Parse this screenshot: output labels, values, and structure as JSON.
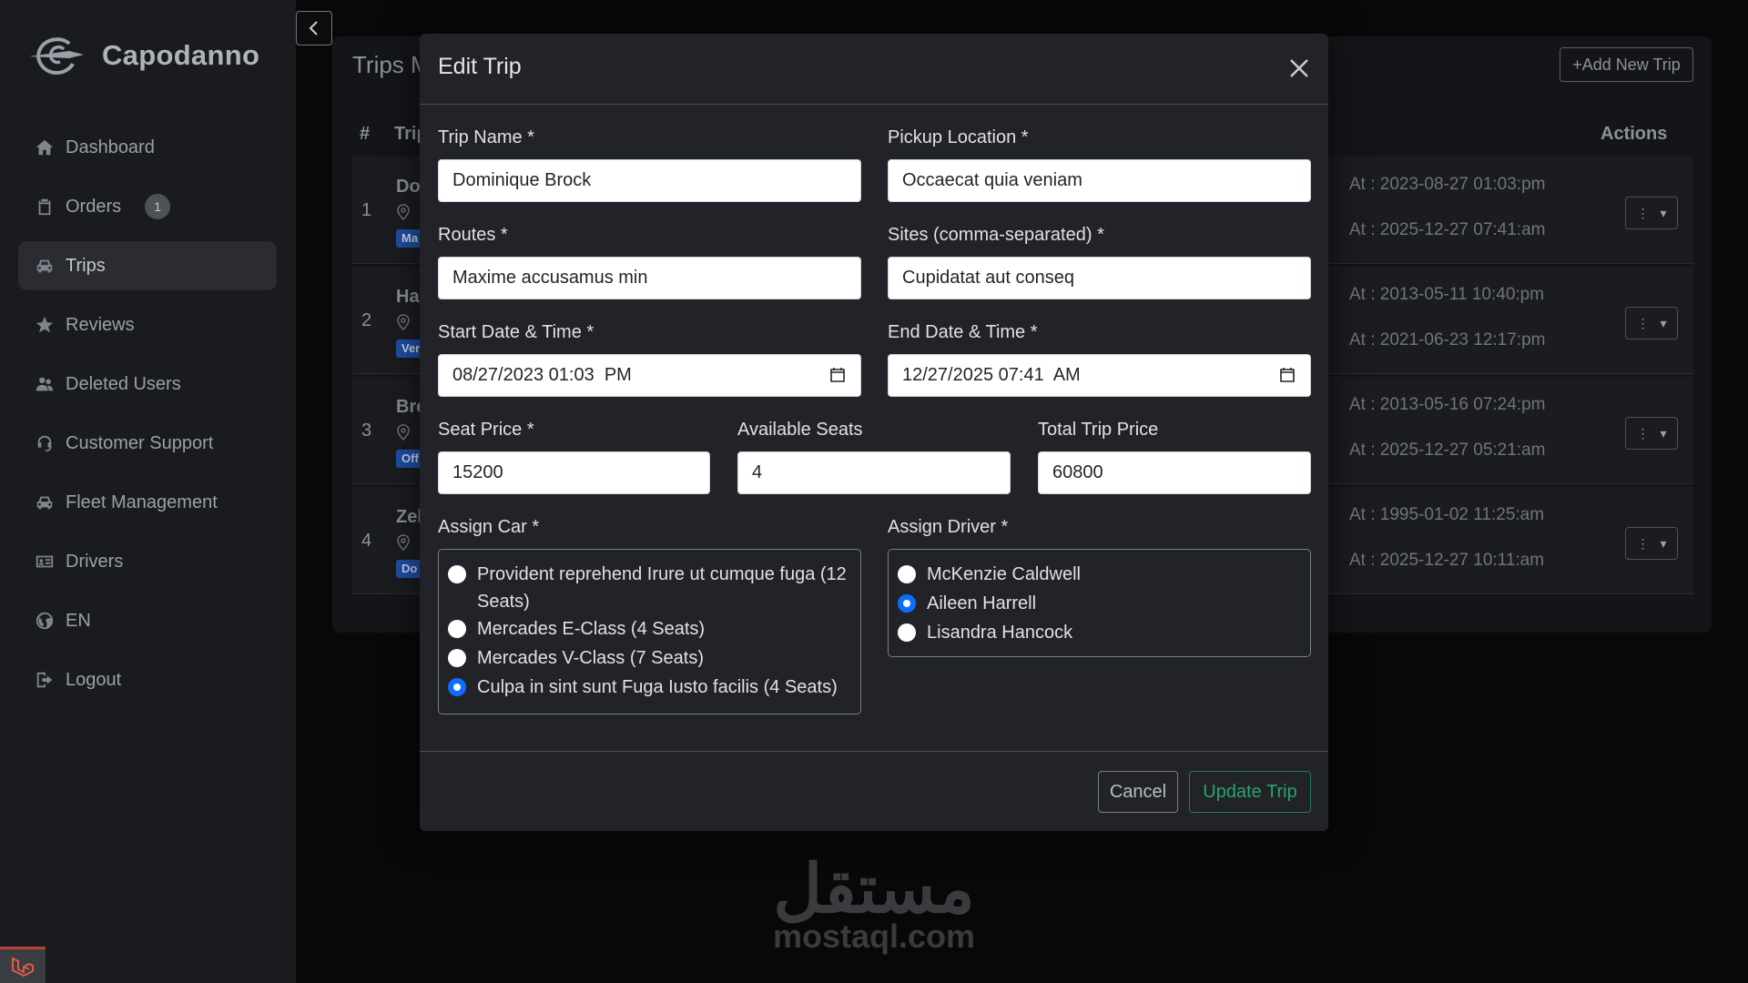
{
  "app": {
    "name": "Capodanno"
  },
  "sidebar": {
    "items": [
      {
        "label": "Dashboard",
        "icon": "home-icon"
      },
      {
        "label": "Orders",
        "icon": "clipboard-icon",
        "badge": "1"
      },
      {
        "label": "Trips",
        "icon": "car-icon",
        "active": true
      },
      {
        "label": "Reviews",
        "icon": "star-icon"
      },
      {
        "label": "Deleted Users",
        "icon": "users-icon"
      },
      {
        "label": "Customer Support",
        "icon": "headset-icon"
      },
      {
        "label": "Fleet Management",
        "icon": "car-icon"
      },
      {
        "label": "Drivers",
        "icon": "id-card-icon"
      },
      {
        "label": "EN",
        "icon": "globe-icon"
      },
      {
        "label": "Logout",
        "icon": "logout-icon"
      }
    ]
  },
  "page": {
    "title": "Trips M",
    "add_button": "+Add New Trip",
    "columns": {
      "num": "#",
      "trip": "Trip",
      "actions": "Actions"
    },
    "rows": [
      {
        "num": "1",
        "name": "Do",
        "pin": "c",
        "tag": "Ma",
        "t1": "At : 2023-08-27 01:03:pm",
        "t2": "At : 2025-12-27 07:41:am"
      },
      {
        "num": "2",
        "name": "Ha",
        "pin": "l",
        "tag": "Ver",
        "t1": "At : 2013-05-11 10:40:pm",
        "t2": "At : 2021-06-23 12:17:pm"
      },
      {
        "num": "3",
        "name": "Bre",
        "pin": "l",
        "tag": "Off",
        "t1": "At : 2013-05-16 07:24:pm",
        "t2": "At : 2025-12-27 05:21:am"
      },
      {
        "num": "4",
        "name": "Zel",
        "pin": "A",
        "tag": "Do",
        "t1": "At : 1995-01-02 11:25:am",
        "t2": "At : 2025-12-27 10:11:am"
      }
    ]
  },
  "modal": {
    "title": "Edit Trip",
    "trip_name": {
      "label": "Trip Name *",
      "value": "Dominique Brock"
    },
    "pickup": {
      "label": "Pickup Location *",
      "value": "Occaecat quia veniam"
    },
    "routes": {
      "label": "Routes *",
      "value": "Maxime accusamus min"
    },
    "sites": {
      "label": "Sites (comma-separated) *",
      "value": "Cupidatat aut conseq"
    },
    "start": {
      "label": "Start Date & Time *",
      "value": "08/27/2023 01:03  PM"
    },
    "end": {
      "label": "End Date & Time *",
      "value": "12/27/2025 07:41  AM"
    },
    "seat_price": {
      "label": "Seat Price *",
      "value": "15200"
    },
    "available_seats": {
      "label": "Available Seats",
      "value": "4"
    },
    "total_price": {
      "label": "Total Trip Price",
      "value": "60800"
    },
    "cars": {
      "label": "Assign Car *",
      "options": [
        {
          "label": "Provident reprehend Irure ut cumque fuga (12 Seats)",
          "selected": false
        },
        {
          "label": "Mercades E-Class (4 Seats)",
          "selected": false
        },
        {
          "label": "Mercades V-Class (7 Seats)",
          "selected": false
        },
        {
          "label": "Culpa in sint sunt Fuga Iusto facilis (4 Seats)",
          "selected": true
        }
      ]
    },
    "drivers": {
      "label": "Assign Driver *",
      "options": [
        {
          "label": "McKenzie Caldwell",
          "selected": false
        },
        {
          "label": "Aileen Harrell",
          "selected": true
        },
        {
          "label": "Lisandra Hancock",
          "selected": false
        }
      ]
    },
    "cancel": "Cancel",
    "update": "Update Trip"
  },
  "watermark": {
    "arabic": "مستقل",
    "latin": "mostaql.com"
  },
  "colors": {
    "primary": "#0d6efd",
    "success": "#198754",
    "badge": "#1f4ea5"
  }
}
